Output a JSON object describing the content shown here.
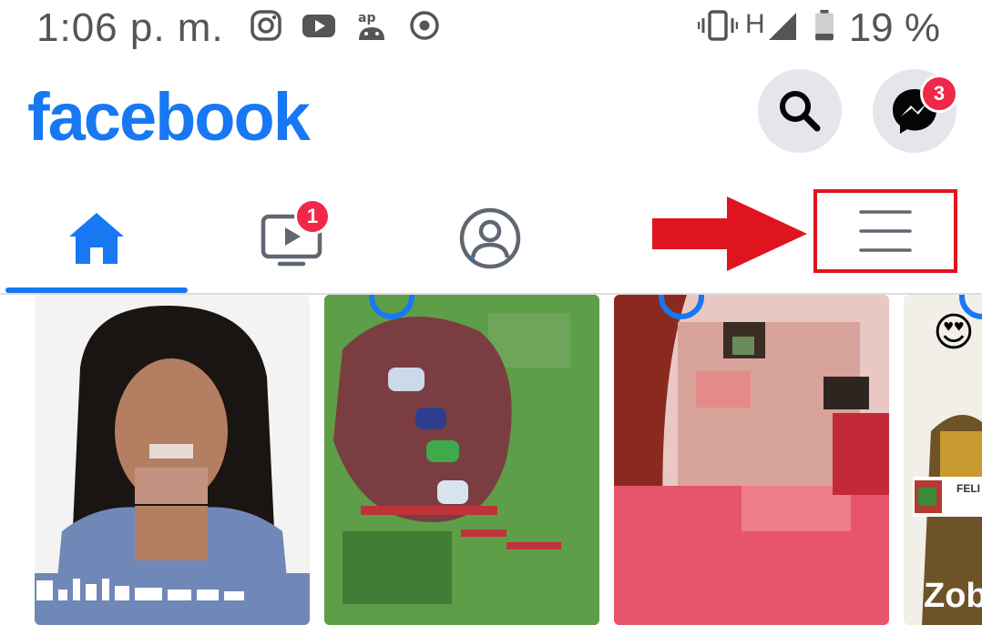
{
  "status_bar": {
    "time": "1:06 p. m.",
    "network": "H",
    "battery": "19 %",
    "icons": [
      "instagram-icon",
      "youtube-icon",
      "android-icon",
      "record-icon",
      "vibrate-icon",
      "signal-icon",
      "battery-icon"
    ]
  },
  "header": {
    "logo": "facebook",
    "search_icon": "search-icon",
    "messenger_icon": "messenger-icon",
    "messenger_badge": "3"
  },
  "tabs": {
    "home_icon": "home-icon",
    "watch_icon": "watch-icon",
    "watch_badge": "1",
    "profile_icon": "profile-icon",
    "menu_icon": "menu-icon"
  },
  "colors": {
    "brand": "#1877f2",
    "badge": "#f02849",
    "annotation": "#e0141e"
  },
  "stories": [
    {
      "name": ""
    },
    {
      "name": ""
    },
    {
      "name": ""
    },
    {
      "name": "Zob",
      "tag": "FELI",
      "emoji": "😍"
    }
  ]
}
